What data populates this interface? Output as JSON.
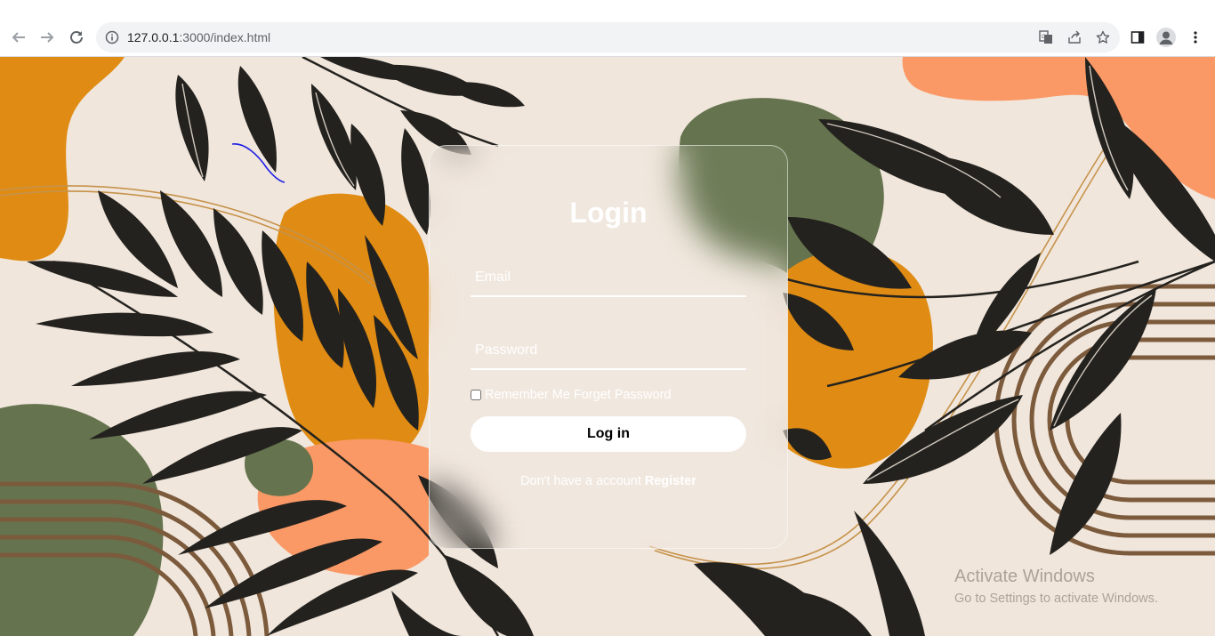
{
  "browser": {
    "url_host": "127.0.0.1",
    "url_path": ":3000/index.html",
    "icons": [
      "back-icon",
      "forward-icon",
      "reload-icon",
      "site-info-icon",
      "translate-icon",
      "share-icon",
      "bookmark-star-icon",
      "side-panel-icon",
      "profile-icon",
      "menu-icon"
    ]
  },
  "login": {
    "title": "Login",
    "email_placeholder": "Email",
    "password_placeholder": "Password",
    "remember_label": "Remember Me",
    "forgot_label": "Forget Password",
    "submit_label": "Log in",
    "register_prompt": "Don't have a account",
    "register_link": "Register"
  },
  "watermark": {
    "title": "Activate Windows",
    "subtitle": "Go to Settings to activate Windows."
  },
  "colors": {
    "background": "#f0e6dc",
    "mustard": "#e08c14",
    "olive": "#65744e",
    "salmon": "#fb9966",
    "leaf": "#24221e",
    "stripe": "#7c5a3c"
  }
}
